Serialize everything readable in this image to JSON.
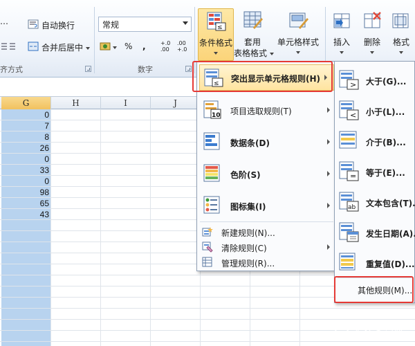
{
  "ribbon": {
    "wrap_text_label": "自动换行",
    "merge_center_label": "合并后居中",
    "alignment_group_label": "齐方式",
    "number_format_value": "常规",
    "percent_symbol": "%",
    "comma_symbol": ",",
    "increase_decimal_label": "+.0 .00",
    "decrease_decimal_label": ".00 +.0",
    "number_group_label": "数字",
    "conditional_format_label": "条件格式",
    "table_format_label_line1": "套用",
    "table_format_label_line2": "表格格式",
    "cell_styles_label": "单元格样式",
    "insert_label": "插入",
    "delete_label": "删除",
    "format_label": "格式"
  },
  "sheet": {
    "columns": [
      "G",
      "H",
      "I",
      "J"
    ],
    "selected_column": "G",
    "values": [
      "0",
      "7",
      "8",
      "26",
      "0",
      "33",
      "0",
      "98",
      "65",
      "43"
    ]
  },
  "menu": {
    "items": [
      {
        "label": "突出显示单元格规则(H)",
        "icon": "highlight-rules-icon",
        "highlighted": true
      },
      {
        "label": "项目选取规则(T)",
        "icon": "top-bottom-rules-icon"
      },
      {
        "label": "数据条(D)",
        "icon": "data-bars-icon"
      },
      {
        "label": "色阶(S)",
        "icon": "color-scales-icon"
      },
      {
        "label": "图标集(I)",
        "icon": "icon-sets-icon"
      }
    ],
    "actions": [
      {
        "label": "新建规则(N)...",
        "icon": "new-rule-icon"
      },
      {
        "label": "清除规则(C)",
        "icon": "clear-rules-icon"
      },
      {
        "label": "管理规则(R)...",
        "icon": "manage-rules-icon"
      }
    ]
  },
  "submenu": {
    "items": [
      {
        "label": "大于(G)...",
        "icon": "greater-than-icon"
      },
      {
        "label": "小于(L)...",
        "icon": "less-than-icon"
      },
      {
        "label": "介于(B)...",
        "icon": "between-icon"
      },
      {
        "label": "等于(E)...",
        "icon": "equal-to-icon"
      },
      {
        "label": "文本包含(T)...",
        "icon": "text-contains-icon"
      },
      {
        "label": "发生日期(A)...",
        "icon": "date-occurring-icon"
      },
      {
        "label": "重复值(D)...",
        "icon": "duplicate-values-icon"
      }
    ],
    "more_rules": "其他规则(M)..."
  },
  "watermark": {
    "text": "头条@问答"
  },
  "colors": {
    "selection": "#b8d3ef",
    "highlight_border": "#e53935",
    "menu_hover": "#ffe4a0"
  }
}
